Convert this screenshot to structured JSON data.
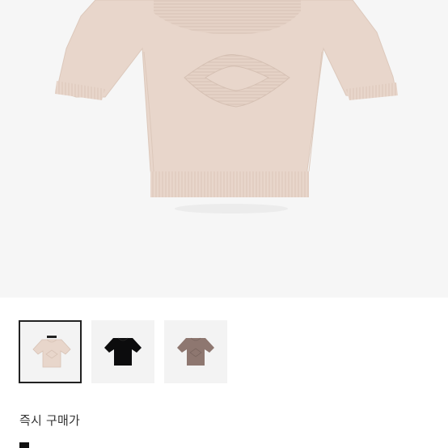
{
  "product": {
    "main_image_icon": "knit-top-beige-image",
    "colors": {
      "beige": "#e8d6cb",
      "black": "#0c0c0d",
      "brown": "#8e7770"
    },
    "thumbnails": [
      {
        "name": "beige",
        "selected": true
      },
      {
        "name": "black",
        "selected": false
      },
      {
        "name": "brown",
        "selected": false
      }
    ],
    "instant_buy_label": "즉시 구매가"
  }
}
